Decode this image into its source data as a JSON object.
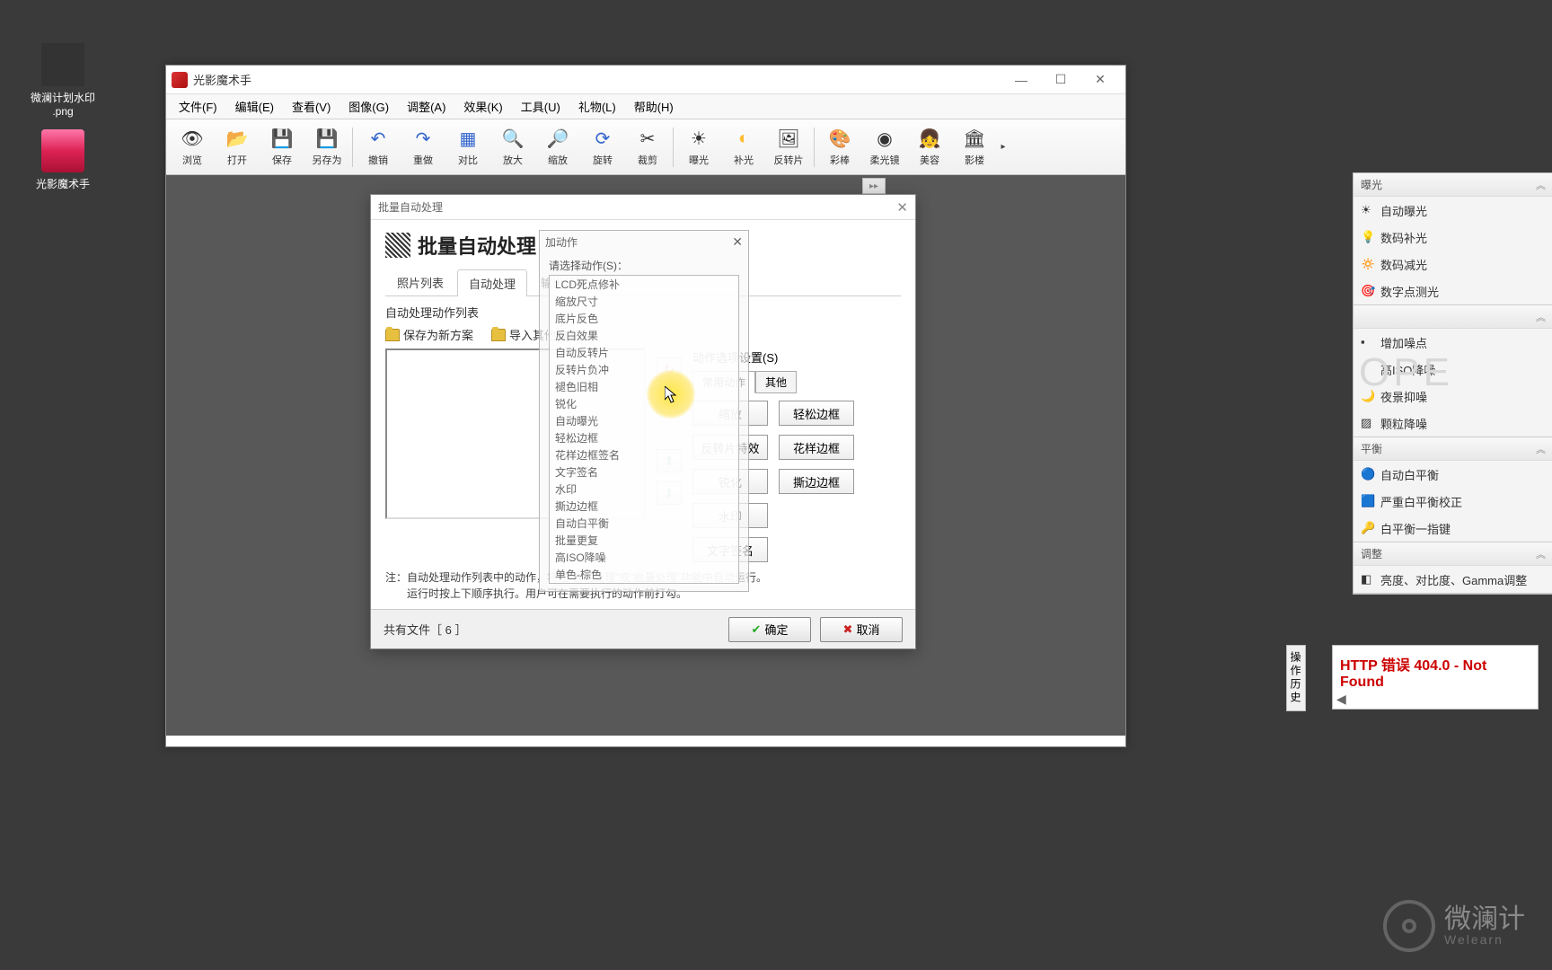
{
  "desktop": {
    "icon1": "微澜计划水印 .png",
    "icon2": "光影魔术手"
  },
  "app": {
    "title": "光影魔术手",
    "menu": [
      "文件(F)",
      "编辑(E)",
      "查看(V)",
      "图像(G)",
      "调整(A)",
      "效果(K)",
      "工具(U)",
      "礼物(L)",
      "帮助(H)"
    ],
    "toolbar": [
      {
        "label": "浏览"
      },
      {
        "label": "打开"
      },
      {
        "label": "保存"
      },
      {
        "label": "另存为"
      },
      {
        "label": "撤销"
      },
      {
        "label": "重做"
      },
      {
        "label": "对比"
      },
      {
        "label": "放大"
      },
      {
        "label": "缩放"
      },
      {
        "label": "旋转"
      },
      {
        "label": "裁剪"
      },
      {
        "label": "曝光"
      },
      {
        "label": "补光"
      },
      {
        "label": "反转片"
      },
      {
        "label": "彩棒"
      },
      {
        "label": "柔光镜"
      },
      {
        "label": "美容"
      },
      {
        "label": "影楼"
      }
    ]
  },
  "panels": {
    "sec1": {
      "title": "曝光",
      "items": [
        "自动曝光",
        "数码补光",
        "数码减光",
        "数字点测光"
      ]
    },
    "sec2": {
      "title": "",
      "items": [
        "增加噪点",
        "高ISO降噪",
        "夜景抑噪",
        "颗粒降噪"
      ]
    },
    "sec3": {
      "title": "平衡",
      "items": [
        "自动白平衡",
        "严重白平衡校正",
        "白平衡一指键"
      ]
    },
    "sec4": {
      "title": "调整",
      "items": [
        "亮度、对比度、Gamma调整"
      ]
    }
  },
  "dialog": {
    "winTitle": "批量自动处理",
    "bigTitle": "批量自动处理",
    "tabs": [
      "照片列表",
      "自动处理",
      "输出设置"
    ],
    "subTitle": "自动处理动作列表",
    "saveNew": "保存为新方案",
    "loadOther": "导入其他方案",
    "optTitle": "动作选项设置(S)",
    "optTabs": [
      "常用动作",
      "其他"
    ],
    "btns": [
      "缩放",
      "轻松边框",
      "反转片特效",
      "花样边框",
      "锐化",
      "撕边边框",
      "水印",
      "文字签名"
    ],
    "note1": "注：自动处理动作列表中的动作，将在\"自动处理\"或\"批量处理\"功能中自动运行。",
    "note2": "　　运行时按上下顺序执行。用户可在需要执行的动作前打勾。",
    "fileCount": "共有文件［ 6 ］",
    "ok": "确定",
    "cancel": "取消"
  },
  "ghost": {
    "title": "加动作",
    "label": "请选择动作(S)：",
    "items": [
      "LCD死点修补",
      "缩放尺寸",
      "底片反色",
      "反白效果",
      "自动反转片",
      "反转片负冲",
      "褪色旧相",
      "锐化",
      "自动曝光",
      "轻松边框",
      "花样边框签名",
      "文字签名",
      "水印",
      "撕边边框",
      "自动白平衡",
      "批量更复",
      "高ISO降噪",
      "单色-棕色"
    ]
  },
  "edgeTab": "操作历史",
  "error": "HTTP 错误 404.0 - Not Found",
  "watermark": {
    "text": "微澜计",
    "sub": "Welearn"
  },
  "ope": "OPE"
}
